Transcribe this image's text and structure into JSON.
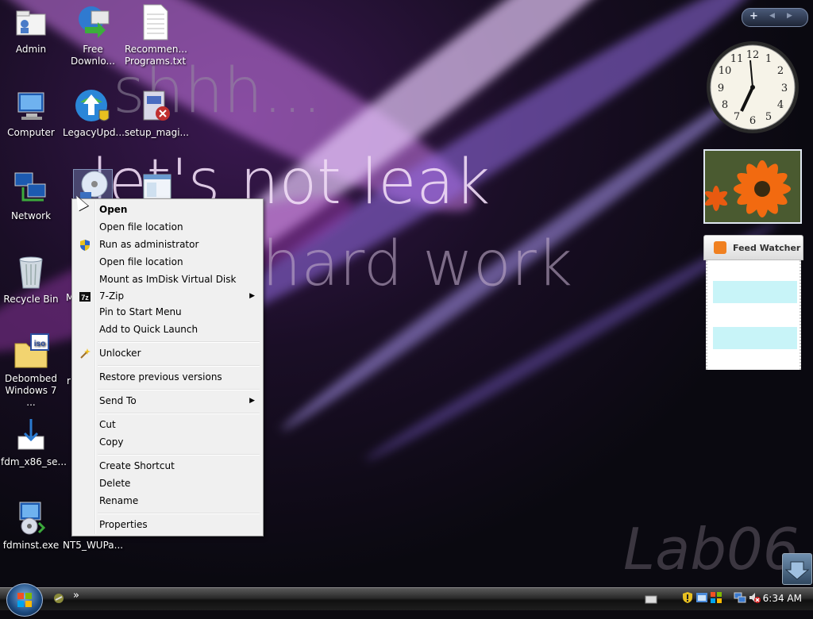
{
  "wallpaper": {
    "line1": "shhh...",
    "line2": "let's not leak",
    "line3": "hard work",
    "brand": "Lab06"
  },
  "desktop_icons": [
    {
      "id": "admin",
      "label": "Admin"
    },
    {
      "id": "free-download",
      "label": "Free Downlo..."
    },
    {
      "id": "recommended",
      "label": "Recommen... Programs.txt"
    },
    {
      "id": "computer",
      "label": "Computer"
    },
    {
      "id": "legacyupd",
      "label": "LegacyUpd..."
    },
    {
      "id": "setup-magic",
      "label": "setup_magi..."
    },
    {
      "id": "network",
      "label": "Network"
    },
    {
      "id": "recycle-bin",
      "label": "Recycle Bin"
    },
    {
      "id": "debombed",
      "label": "Debombed Windows 7 ..."
    },
    {
      "id": "fdm-setup",
      "label": "fdm_x86_se..."
    },
    {
      "id": "fdminst",
      "label": "fdminst.exe"
    },
    {
      "id": "nt5-wupa",
      "label": "NT5_WUPa..."
    }
  ],
  "gadgets": {
    "feed_title": "Feed Watcher"
  },
  "context_menu": {
    "items": [
      {
        "label": "Open",
        "bold": true
      },
      {
        "label": "Open file location"
      },
      {
        "label": "Run as administrator",
        "icon": "uac-shield-icon"
      },
      {
        "label": "Open file location"
      },
      {
        "label": "Mount as ImDisk Virtual Disk"
      },
      {
        "label": "7-Zip",
        "icon": "7zip-icon",
        "submenu": true
      },
      {
        "label": "Pin to Start Menu"
      },
      {
        "label": "Add to Quick Launch"
      },
      {
        "label": "Unlocker",
        "icon": "wand-icon"
      },
      {
        "label": "Restore previous versions"
      },
      {
        "label": "Send To",
        "submenu": true
      },
      {
        "label": "Cut"
      },
      {
        "label": "Copy"
      },
      {
        "label": "Create Shortcut"
      },
      {
        "label": "Delete"
      },
      {
        "label": "Rename"
      },
      {
        "label": "Properties"
      }
    ]
  },
  "taskbar": {
    "time": "6:34 AM",
    "quicklaunch_chevron": "»"
  },
  "colors": {
    "menu_bg": "#f0f0f0",
    "menu_border": "#979797",
    "feed_row": "#c8f4f8"
  }
}
